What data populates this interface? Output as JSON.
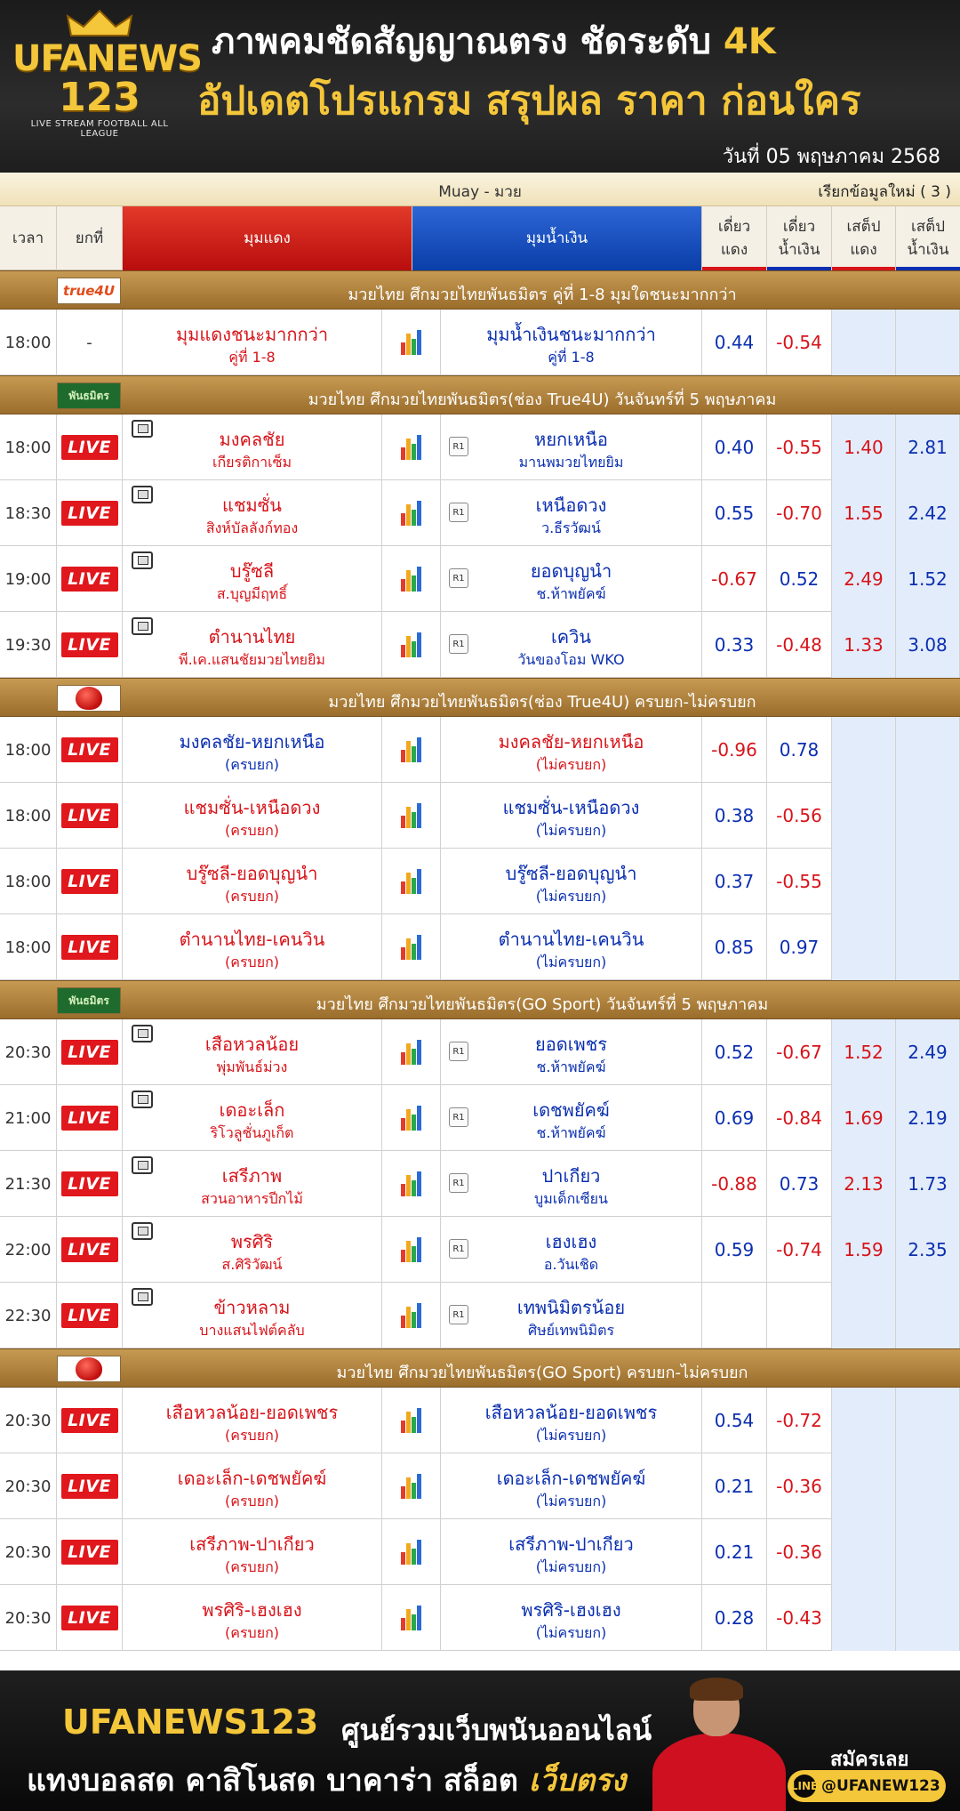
{
  "header": {
    "logo_top": "UFANEWS",
    "logo_num": "123",
    "logo_tag": "LIVE STREAM FOOTBALL ALL LEAGUE",
    "line1": "ภาพคมชัดสัญญาณตรง ชัดระดับ ",
    "line1_hl": "4K",
    "line2": "อัปเดตโปรแกรม สรุปผล ราคา ก่อนใคร",
    "date": "วันที่ 05 พฤษภาคม 2568"
  },
  "titlebar": {
    "title": "Muay - มวย",
    "refresh": "เรียกข้อมูลใหม่ ( 3 )"
  },
  "columns": {
    "time": "เวลา",
    "round": "ยกที่",
    "red": "มุมแดง",
    "blue": "มุมน้ำเงิน",
    "single_red": [
      "เดี่ยว",
      "แดง"
    ],
    "single_blue": [
      "เดี่ยว",
      "น้ำเงิน"
    ],
    "set_red": [
      "เสต็ป",
      "แดง"
    ],
    "set_blue": [
      "เสต็ป",
      "น้ำเงิน"
    ]
  },
  "watermark": {
    "w1": "UFANEWS",
    "w2": "123",
    "w3": "LIVE STREAM FOOTBALL ALL LEAGUE"
  },
  "sections": [
    {
      "icon": "true4u-logo",
      "icon_text": "true4U",
      "title": "มวยไทย ศึกมวยไทยพันธมิตร คู่ที่ 1-8 มุมใดชนะมากกว่า",
      "rows": [
        {
          "time": "18:00",
          "round": "-",
          "red": "มุมแดงชนะมากกว่า",
          "red_sub": "คู่ที่ 1-8",
          "blue": "มุมน้ำเงินชนะมากกว่า",
          "blue_sub": "คู่ที่ 1-8",
          "v1": "0.44",
          "v2": "-0.54",
          "v3": "",
          "v4": "",
          "tv": false
        }
      ]
    },
    {
      "icon": "scoreboard-icon",
      "icon_text": "พันธมิตร",
      "title": "มวยไทย ศึกมวยไทยพันธมิตร(ช่อง True4U) วันจันทร์ที่ 5 พฤษภาคม",
      "rows": [
        {
          "time": "18:00",
          "round": "LIVE",
          "red": "มงคลชัย",
          "red_sub": "เกียรติกาเซ็ม",
          "blue": "หยกเหนือ",
          "blue_sub": "มานพมวยไทยยิม",
          "v1": "0.40",
          "v2": "-0.55",
          "v3": "1.40",
          "v4": "2.81",
          "tv": true
        },
        {
          "time": "18:30",
          "round": "LIVE",
          "red": "แชมซั่น",
          "red_sub": "สิงห์บัลลังก์ทอง",
          "blue": "เหนือดวง",
          "blue_sub": "ว.ธีรวัฒน์",
          "v1": "0.55",
          "v2": "-0.70",
          "v3": "1.55",
          "v4": "2.42",
          "tv": true
        },
        {
          "time": "19:00",
          "round": "LIVE",
          "red": "บรู๊ซลี",
          "red_sub": "ส.บุญมีฤทธิ์",
          "blue": "ยอดบุญนำ",
          "blue_sub": "ช.ห้าพยัคฆ์",
          "v1": "-0.67",
          "v2": "0.52",
          "v3": "2.49",
          "v4": "1.52",
          "tv": true
        },
        {
          "time": "19:30",
          "round": "LIVE",
          "red": "ตำนานไทย",
          "red_sub": "พี.เค.แสนชัยมวยไทยยิม",
          "blue": "เควิน",
          "blue_sub": "วันของโอม WKO",
          "v1": "0.33",
          "v2": "-0.48",
          "v3": "1.33",
          "v4": "3.08",
          "tv": true
        }
      ]
    },
    {
      "icon": "boxing-glove-icon",
      "icon_text": "",
      "title": "มวยไทย ศึกมวยไทยพันธมิตร(ช่อง True4U) ครบยก-ไม่ครบยก",
      "rows": [
        {
          "time": "18:00",
          "round": "LIVE",
          "red": "มงคลชัย-หยกเหนือ",
          "red_sub": "(ครบยก)",
          "blue": "มงคลชัย-หยกเหนือ",
          "blue_sub": "(ไม่ครบยก)",
          "v1": "-0.96",
          "v2": "0.78",
          "v3": "",
          "v4": "",
          "tv": false,
          "redblue_swap": true
        },
        {
          "time": "18:00",
          "round": "LIVE",
          "red": "แชมซั่น-เหนือดวง",
          "red_sub": "(ครบยก)",
          "blue": "แชมซั่น-เหนือดวง",
          "blue_sub": "(ไม่ครบยก)",
          "v1": "0.38",
          "v2": "-0.56",
          "v3": "",
          "v4": "",
          "tv": false
        },
        {
          "time": "18:00",
          "round": "LIVE",
          "red": "บรู๊ซลี-ยอดบุญนำ",
          "red_sub": "(ครบยก)",
          "blue": "บรู๊ซลี-ยอดบุญนำ",
          "blue_sub": "(ไม่ครบยก)",
          "v1": "0.37",
          "v2": "-0.55",
          "v3": "",
          "v4": "",
          "tv": false
        },
        {
          "time": "18:00",
          "round": "LIVE",
          "red": "ตำนานไทย-เคนวิน",
          "red_sub": "(ครบยก)",
          "blue": "ตำนานไทย-เคนวิน",
          "blue_sub": "(ไม่ครบยก)",
          "v1": "0.85",
          "v2": "0.97",
          "v3": "",
          "v4": "",
          "tv": false
        }
      ]
    },
    {
      "icon": "scoreboard-icon",
      "icon_text": "พันธมิตร",
      "title": "มวยไทย ศึกมวยไทยพันธมิตร(GO Sport) วันจันทร์ที่ 5 พฤษภาคม",
      "rows": [
        {
          "time": "20:30",
          "round": "LIVE",
          "red": "เสือหวลน้อย",
          "red_sub": "พุ่มพันธ์ม่วง",
          "blue": "ยอดเพชร",
          "blue_sub": "ช.ห้าพยัคฆ์",
          "v1": "0.52",
          "v2": "-0.67",
          "v3": "1.52",
          "v4": "2.49",
          "tv": true
        },
        {
          "time": "21:00",
          "round": "LIVE",
          "red": "เดอะเล็ก",
          "red_sub": "ริโวลูชั่นภูเก็ต",
          "blue": "เดชพยัคฆ์",
          "blue_sub": "ช.ห้าพยัคฆ์",
          "v1": "0.69",
          "v2": "-0.84",
          "v3": "1.69",
          "v4": "2.19",
          "tv": true
        },
        {
          "time": "21:30",
          "round": "LIVE",
          "red": "เสรีภาพ",
          "red_sub": "สวนอาหารปีกไม้",
          "blue": "ปาเกียว",
          "blue_sub": "บูมเด็กเซียน",
          "v1": "-0.88",
          "v2": "0.73",
          "v3": "2.13",
          "v4": "1.73",
          "tv": true
        },
        {
          "time": "22:00",
          "round": "LIVE",
          "red": "พรศิริ",
          "red_sub": "ส.ศิริวัฒน์",
          "blue": "เฮงเฮง",
          "blue_sub": "อ.วันเชิด",
          "v1": "0.59",
          "v2": "-0.74",
          "v3": "1.59",
          "v4": "2.35",
          "tv": true
        },
        {
          "time": "22:30",
          "round": "LIVE",
          "red": "ข้าวหลาม",
          "red_sub": "บางแสนไฟต์คลับ",
          "blue": "เทพนิมิตรน้อย",
          "blue_sub": "ศิษย์เทพนิมิตร",
          "v1": "",
          "v2": "",
          "v3": "",
          "v4": "",
          "tv": true
        }
      ]
    },
    {
      "icon": "boxing-glove-icon",
      "icon_text": "",
      "title": "มวยไทย ศึกมวยไทยพันธมิตร(GO Sport) ครบยก-ไม่ครบยก",
      "rows": [
        {
          "time": "20:30",
          "round": "LIVE",
          "red": "เสือหวลน้อย-ยอดเพชร",
          "red_sub": "(ครบยก)",
          "blue": "เสือหวลน้อย-ยอดเพชร",
          "blue_sub": "(ไม่ครบยก)",
          "v1": "0.54",
          "v2": "-0.72",
          "v3": "",
          "v4": "",
          "tv": false
        },
        {
          "time": "20:30",
          "round": "LIVE",
          "red": "เดอะเล็ก-เดชพยัคฆ์",
          "red_sub": "(ครบยก)",
          "blue": "เดอะเล็ก-เดชพยัคฆ์",
          "blue_sub": "(ไม่ครบยก)",
          "v1": "0.21",
          "v2": "-0.36",
          "v3": "",
          "v4": "",
          "tv": false
        },
        {
          "time": "20:30",
          "round": "LIVE",
          "red": "เสรีภาพ-ปาเกียว",
          "red_sub": "(ครบยก)",
          "blue": "เสรีภาพ-ปาเกียว",
          "blue_sub": "(ไม่ครบยก)",
          "v1": "0.21",
          "v2": "-0.36",
          "v3": "",
          "v4": "",
          "tv": false
        },
        {
          "time": "20:30",
          "round": "LIVE",
          "red": "พรศิริ-เฮงเฮง",
          "red_sub": "(ครบยก)",
          "blue": "พรศิริ-เฮงเฮง",
          "blue_sub": "(ไม่ครบยก)",
          "v1": "0.28",
          "v2": "-0.43",
          "v3": "",
          "v4": "",
          "tv": false
        }
      ]
    }
  ],
  "footer": {
    "brand": "UFANEWS123",
    "tagline": "ศูนย์รวมเว็บพนันออนไลน์",
    "line2": "แทงบอลสด คาสิโนสด บาคาร่า สล็อต ",
    "line2_hl": "เว็บตรง",
    "signup": "สมัครเลย",
    "line_id": "@UFANEW123",
    "line_icon": "LINE"
  },
  "colors": {
    "red": "#d7141a",
    "blue": "#0b2fb0",
    "gold": "#f4c63a",
    "section": "#b3843f"
  }
}
